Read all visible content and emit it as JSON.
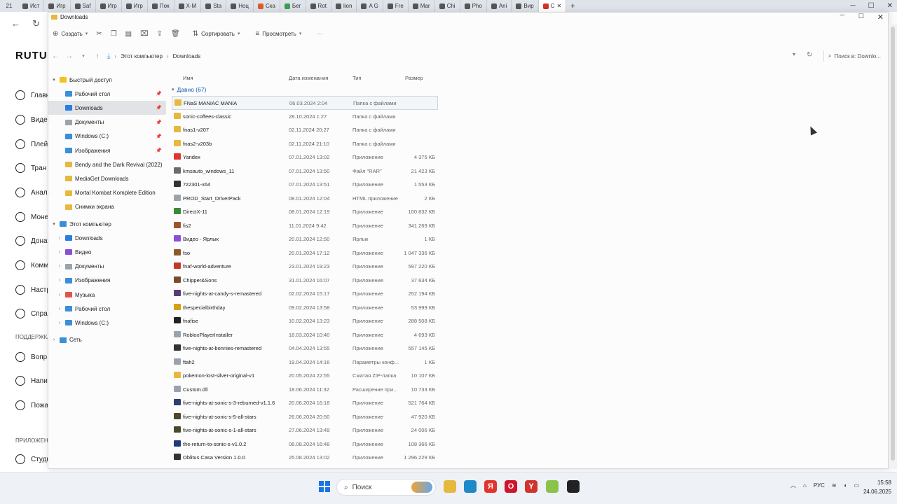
{
  "browser": {
    "tab_count": "21",
    "tabs": [
      {
        "label": "Ист",
        "color": "#555555"
      },
      {
        "label": "Игр",
        "color": "#555555"
      },
      {
        "label": "Saf",
        "color": "#555555"
      },
      {
        "label": "Игр",
        "color": "#555555"
      },
      {
        "label": "Игр",
        "color": "#555555"
      },
      {
        "label": "Пок",
        "color": "#555555"
      },
      {
        "label": "X-M",
        "color": "#555555"
      },
      {
        "label": "Sta",
        "color": "#555555"
      },
      {
        "label": "Ноц",
        "color": "#555555"
      },
      {
        "label": "Ска",
        "color": "#e05a2b"
      },
      {
        "label": "Бег",
        "color": "#3aa050"
      },
      {
        "label": "Rot",
        "color": "#555555"
      },
      {
        "label": "lion",
        "color": "#555555"
      },
      {
        "label": "A G",
        "color": "#555555"
      },
      {
        "label": "Fre",
        "color": "#555555"
      },
      {
        "label": "Mar",
        "color": "#555555"
      },
      {
        "label": "Chi",
        "color": "#555555"
      },
      {
        "label": "Pho",
        "color": "#555555"
      },
      {
        "label": "Ani",
        "color": "#555555"
      },
      {
        "label": "Вир",
        "color": "#555555"
      },
      {
        "label": "С",
        "color": "#d0342c",
        "active": true
      }
    ],
    "new_tab": "+"
  },
  "background_site": {
    "logo": "RUTU",
    "nav": [
      {
        "label": "Главн",
        "icon": "home-icon"
      },
      {
        "label": "Видео",
        "icon": "video-icon"
      },
      {
        "label": "Плей",
        "icon": "playlist-icon"
      },
      {
        "label": "Тран",
        "icon": "broadcast-icon"
      },
      {
        "label": "Анали",
        "icon": "analytics-icon"
      },
      {
        "label": "Моне",
        "icon": "money-icon"
      },
      {
        "label": "Донат",
        "icon": "donate-icon"
      },
      {
        "label": "Комм",
        "icon": "comment-icon"
      },
      {
        "label": "Настр",
        "icon": "settings-icon"
      },
      {
        "label": "Справ",
        "icon": "help-icon"
      }
    ],
    "support_head": "ПОДДЕРЖКА",
    "support": [
      {
        "label": "Вопр",
        "icon": "question-icon"
      },
      {
        "label": "Напи",
        "icon": "write-icon"
      },
      {
        "label": "Пожа",
        "icon": "report-icon"
      }
    ],
    "apps_head": "ПРИЛОЖЕН",
    "apps": [
      {
        "label": "Студи",
        "icon": "studio-icon"
      }
    ]
  },
  "explorer": {
    "title": "Downloads",
    "cmd": {
      "create": "Создать",
      "sort": "Сортировать",
      "view": "Просмотреть",
      "more": "···"
    },
    "breadcrumb": [
      "Этот компьютер",
      "Downloads"
    ],
    "search_placeholder": "Поиск в: Downlo...",
    "nav": {
      "quick_access": "Быстрый доступ",
      "quick_items": [
        {
          "label": "Рабочий стол",
          "color": "#3b8ed8",
          "pinned": true
        },
        {
          "label": "Downloads",
          "color": "#2a7de1",
          "pinned": true,
          "selected": true
        },
        {
          "label": "Документы",
          "color": "#9aa3ad",
          "pinned": true
        },
        {
          "label": "Windows (C:)",
          "color": "#3b8ed8",
          "pinned": true
        },
        {
          "label": "Изображения",
          "color": "#3b8ed8",
          "pinned": true
        },
        {
          "label": "Bendy and the Dark Revival (2022)",
          "color": "#e6b93e"
        },
        {
          "label": "MediaGet Downloads",
          "color": "#e6b93e"
        },
        {
          "label": "Mortal Kombat Komplete Edition",
          "color": "#e6b93e"
        },
        {
          "label": "Снимки экрана",
          "color": "#e6b93e"
        }
      ],
      "this_pc": "Этот компьютер",
      "pc_items": [
        {
          "label": "Downloads",
          "color": "#2a7de1"
        },
        {
          "label": "Видео",
          "color": "#8a4fd8"
        },
        {
          "label": "Документы",
          "color": "#9aa3ad"
        },
        {
          "label": "Изображения",
          "color": "#3b8ed8"
        },
        {
          "label": "Музыка",
          "color": "#e0554a"
        },
        {
          "label": "Рабочий стол",
          "color": "#3b8ed8"
        },
        {
          "label": "Windows (C:)",
          "color": "#3b8ed8"
        }
      ],
      "network": "Сеть"
    },
    "columns": {
      "name": "Имя",
      "date": "Дата изменения",
      "type": "Тип",
      "size": "Размер"
    },
    "group": "Давно (67)",
    "files": [
      {
        "name": "FNaS MANIAC MANIA",
        "date": "06.03.2024 2:04",
        "type": "Папка с файлами",
        "size": "",
        "color": "#e6b93e",
        "selected": true
      },
      {
        "name": "sonic-coffees-classic",
        "date": "28.10.2024 1:27",
        "type": "Папка с файлами",
        "size": "",
        "color": "#e6b93e"
      },
      {
        "name": "fnas1-v207",
        "date": "02.11.2024 20:27",
        "type": "Папка с файлами",
        "size": "",
        "color": "#e6b93e"
      },
      {
        "name": "fnas2-v203b",
        "date": "02.11.2024 21:10",
        "type": "Папка с файлами",
        "size": "",
        "color": "#e6b93e"
      },
      {
        "name": "Yandex",
        "date": "07.01.2024 13:02",
        "type": "Приложение",
        "size": "4 375 КБ",
        "color": "#e0342c"
      },
      {
        "name": "kmsauto_windows_11",
        "date": "07.01.2024 13:50",
        "type": "Файл \"RAR\"",
        "size": "21 423 КБ",
        "color": "#6b6b6b"
      },
      {
        "name": "7z2301-x64",
        "date": "07.01.2024 13:51",
        "type": "Приложение",
        "size": "1 553 КБ",
        "color": "#333333"
      },
      {
        "name": "PROD_Start_DriverPack",
        "date": "08.01.2024 12:04",
        "type": "HTML приложение",
        "size": "2 КБ",
        "color": "#9aa3ad"
      },
      {
        "name": "DirectX-11",
        "date": "08.01.2024 12:19",
        "type": "Приложение",
        "size": "100 832 КБ",
        "color": "#3a8a3a"
      },
      {
        "name": "fis2",
        "date": "11.01.2024 9:42",
        "type": "Приложение",
        "size": "341 269 КБ",
        "color": "#a0522d"
      },
      {
        "name": "Видео - Ярлык",
        "date": "20.01.2024 12:50",
        "type": "Ярлык",
        "size": "1 КБ",
        "color": "#8a4fd8"
      },
      {
        "name": "fso",
        "date": "20.01.2024 17:12",
        "type": "Приложение",
        "size": "1 047 336 КБ",
        "color": "#8b5a2b"
      },
      {
        "name": "fnaf-world-adventure",
        "date": "23.01.2024 19:23",
        "type": "Приложение",
        "size": "597 220 КБ",
        "color": "#c0392b"
      },
      {
        "name": "Chipper&Sons",
        "date": "31.01.2024 16:07",
        "type": "Приложение",
        "size": "37 634 КБ",
        "color": "#7a4a2a"
      },
      {
        "name": "five-nights-at-candy-s-remastered",
        "date": "02.02.2024 15:17",
        "type": "Приложение",
        "size": "252 194 КБ",
        "color": "#5a3a7a"
      },
      {
        "name": "thespecialbirthday",
        "date": "09.02.2024 13:58",
        "type": "Приложение",
        "size": "53 999 КБ",
        "color": "#d4a017"
      },
      {
        "name": "fnafise",
        "date": "10.02.2024 13:23",
        "type": "Приложение",
        "size": "288 508 КБ",
        "color": "#222222"
      },
      {
        "name": "RobloxPlayerInstaller",
        "date": "18.03.2024 10:40",
        "type": "Приложение",
        "size": "4 693 КБ",
        "color": "#9aa3ad"
      },
      {
        "name": "five-nights-at-bonnies-remastered",
        "date": "04.04.2024 13:55",
        "type": "Приложение",
        "size": "557 145 КБ",
        "color": "#333333"
      },
      {
        "name": "ftah2",
        "date": "19.04.2024 14:16",
        "type": "Параметры конф...",
        "size": "1 КБ",
        "color": "#9aa3ad"
      },
      {
        "name": "pokemon-lost-silver-original-v1",
        "date": "20.05.2024 22:55",
        "type": "Сжатая ZIP-папка",
        "size": "10 107 КБ",
        "color": "#e6b93e"
      },
      {
        "name": "Custom.dll",
        "date": "18.06.2024 11:32",
        "type": "Расширение при...",
        "size": "10 733 КБ",
        "color": "#9aa3ad"
      },
      {
        "name": "five-nights-at-sonic-s-3-reburned-v1.1.6",
        "date": "20.06.2024 16:18",
        "type": "Приложение",
        "size": "521 764 КБ",
        "color": "#2c3e70"
      },
      {
        "name": "five-nights-at-sonic-s-5-all-stars",
        "date": "26.06.2024 20:50",
        "type": "Приложение",
        "size": "47 920 КБ",
        "color": "#4a4a2a"
      },
      {
        "name": "five-nights-at-sonic-s-1-all-stars",
        "date": "27.06.2024 13:49",
        "type": "Приложение",
        "size": "24 006 КБ",
        "color": "#4a4a2a"
      },
      {
        "name": "the-return-to-sonic-s-v1.0.2",
        "date": "08.08.2024 16:48",
        "type": "Приложение",
        "size": "108 366 КБ",
        "color": "#1f3a7a"
      },
      {
        "name": "Oblitus Casa Version 1.0.0",
        "date": "25.08.2024 13:02",
        "type": "Приложение",
        "size": "1 296 229 КБ",
        "color": "#333333"
      }
    ]
  },
  "taskbar": {
    "search": "Поиск",
    "apps": [
      {
        "icon": "file-explorer-icon",
        "glyph": "",
        "color": "#e6b93e"
      },
      {
        "icon": "edge-icon",
        "glyph": "",
        "color": "#1e88c8"
      },
      {
        "icon": "yandex-icon",
        "glyph": "Я",
        "color": "#e0342c"
      },
      {
        "icon": "opera-icon",
        "glyph": "O",
        "color": "#d0142c"
      },
      {
        "icon": "yandex-browser-icon",
        "glyph": "Y",
        "color": "#d0342c"
      },
      {
        "icon": "mediaget-icon",
        "glyph": "",
        "color": "#8bc34a"
      },
      {
        "icon": "roblox-icon",
        "glyph": "",
        "color": "#222222"
      }
    ],
    "lang": "РУС",
    "time": "15:58",
    "date": "24.06.2025"
  }
}
